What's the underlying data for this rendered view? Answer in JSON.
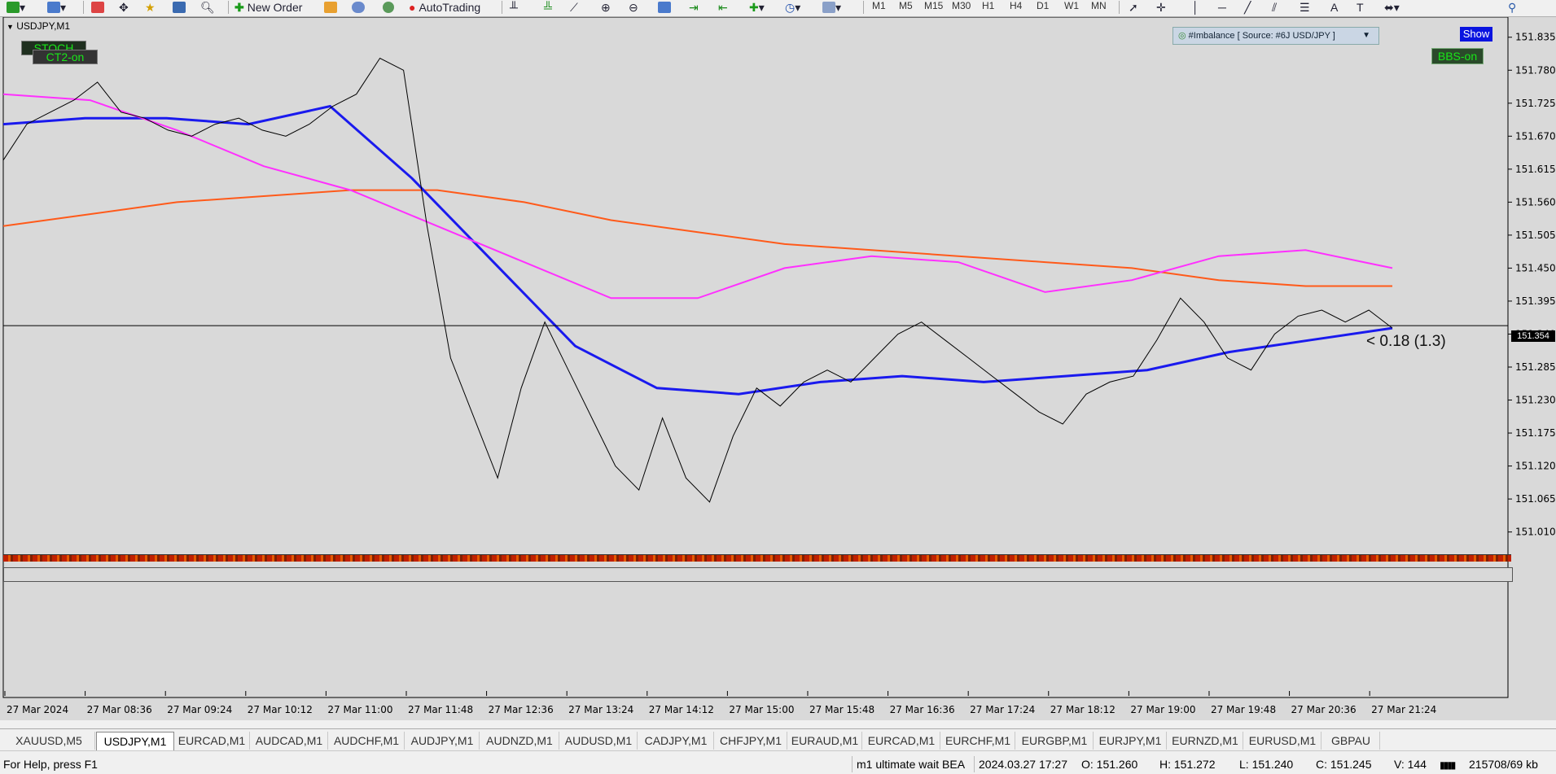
{
  "toolbar": {
    "new_order_label": "New Order",
    "autotrading_label": "AutoTrading",
    "timeframes": [
      "M1",
      "M5",
      "M15",
      "M30",
      "H1",
      "H4",
      "D1",
      "W1",
      "MN"
    ]
  },
  "chart": {
    "symbol_title": "USDJPY,M1",
    "stoch_label": "STOCH",
    "ct2_label": "CT2-on",
    "imbalance_label": "#Imbalance [ Source: #6J USD/JPY ]",
    "show_label": "Show",
    "bbs_label": "BBS-on",
    "imbalance_value": "< 0.18 (1.3)",
    "current_price_tag": "151.354"
  },
  "chart_data": {
    "type": "line",
    "symbol": "USDJPY",
    "timeframe": "M1",
    "price_axis_ticks": [
      "151.835",
      "151.780",
      "151.725",
      "151.670",
      "151.615",
      "151.560",
      "151.505",
      "151.450",
      "151.395",
      "151.340",
      "151.285",
      "151.230",
      "151.175",
      "151.120",
      "151.065",
      "151.010"
    ],
    "time_axis_ticks": [
      "27 Mar 2024",
      "27 Mar 08:36",
      "27 Mar 09:24",
      "27 Mar 10:12",
      "27 Mar 11:00",
      "27 Mar 11:48",
      "27 Mar 12:36",
      "27 Mar 13:24",
      "27 Mar 14:12",
      "27 Mar 15:00",
      "27 Mar 15:48",
      "27 Mar 16:36",
      "27 Mar 17:24",
      "27 Mar 18:12",
      "27 Mar 19:00",
      "27 Mar 19:48",
      "27 Mar 20:36",
      "27 Mar 21:24"
    ],
    "ylim": [
      151.0,
      151.855
    ],
    "current_price": 151.354,
    "price_series": [
      {
        "name": "close",
        "color": "#000000",
        "values": [
          151.63,
          151.69,
          151.71,
          151.73,
          151.76,
          151.71,
          151.7,
          151.68,
          151.67,
          151.69,
          151.7,
          151.68,
          151.67,
          151.69,
          151.72,
          151.74,
          151.8,
          151.78,
          151.52,
          151.3,
          151.2,
          151.1,
          151.25,
          151.36,
          151.28,
          151.2,
          151.12,
          151.08,
          151.2,
          151.1,
          151.06,
          151.17,
          151.25,
          151.22,
          151.26,
          151.28,
          151.26,
          151.3,
          151.34,
          151.36,
          151.33,
          151.3,
          151.27,
          151.24,
          151.21,
          151.19,
          151.24,
          151.26,
          151.27,
          151.33,
          151.4,
          151.36,
          151.3,
          151.28,
          151.34,
          151.37,
          151.38,
          151.36,
          151.38,
          151.35
        ]
      }
    ],
    "indicator_lines": [
      {
        "color": "#ff5a1a",
        "values": [
          151.52,
          151.54,
          151.56,
          151.57,
          151.58,
          151.58,
          151.56,
          151.53,
          151.51,
          151.49,
          151.48,
          151.47,
          151.46,
          151.45,
          151.43,
          151.42,
          151.42
        ]
      },
      {
        "color": "#1a1aee",
        "values": [
          151.69,
          151.7,
          151.7,
          151.69,
          151.72,
          151.6,
          151.46,
          151.32,
          151.25,
          151.24,
          151.26,
          151.27,
          151.26,
          151.27,
          151.28,
          151.31,
          151.33,
          151.35
        ]
      },
      {
        "color": "#ff30ff",
        "values": [
          151.74,
          151.73,
          151.68,
          151.62,
          151.58,
          151.52,
          151.46,
          151.4,
          151.4,
          151.45,
          151.47,
          151.46,
          151.41,
          151.43,
          151.47,
          151.48,
          151.45
        ]
      }
    ]
  },
  "tabs": [
    "XAUUSD,M5",
    "USDJPY,M1",
    "EURCAD,M1",
    "AUDCAD,M1",
    "AUDCHF,M1",
    "AUDJPY,M1",
    "AUDNZD,M1",
    "AUDUSD,M1",
    "CADJPY,M1",
    "CHFJPY,M1",
    "EURAUD,M1",
    "EURCAD,M1",
    "EURCHF,M1",
    "EURGBP,M1",
    "EURJPY,M1",
    "EURNZD,M1",
    "EURUSD,M1",
    "GBPAU"
  ],
  "active_tab": "USDJPY,M1",
  "status": {
    "help": "For Help, press F1",
    "profile": "m1 ultimate wait BEA",
    "datetime": "2024.03.27 17:27",
    "open": "O: 151.260",
    "high": "H: 151.272",
    "low": "L: 151.240",
    "close": "C: 151.245",
    "volume": "V: 144",
    "traffic": "215708/69 kb"
  }
}
